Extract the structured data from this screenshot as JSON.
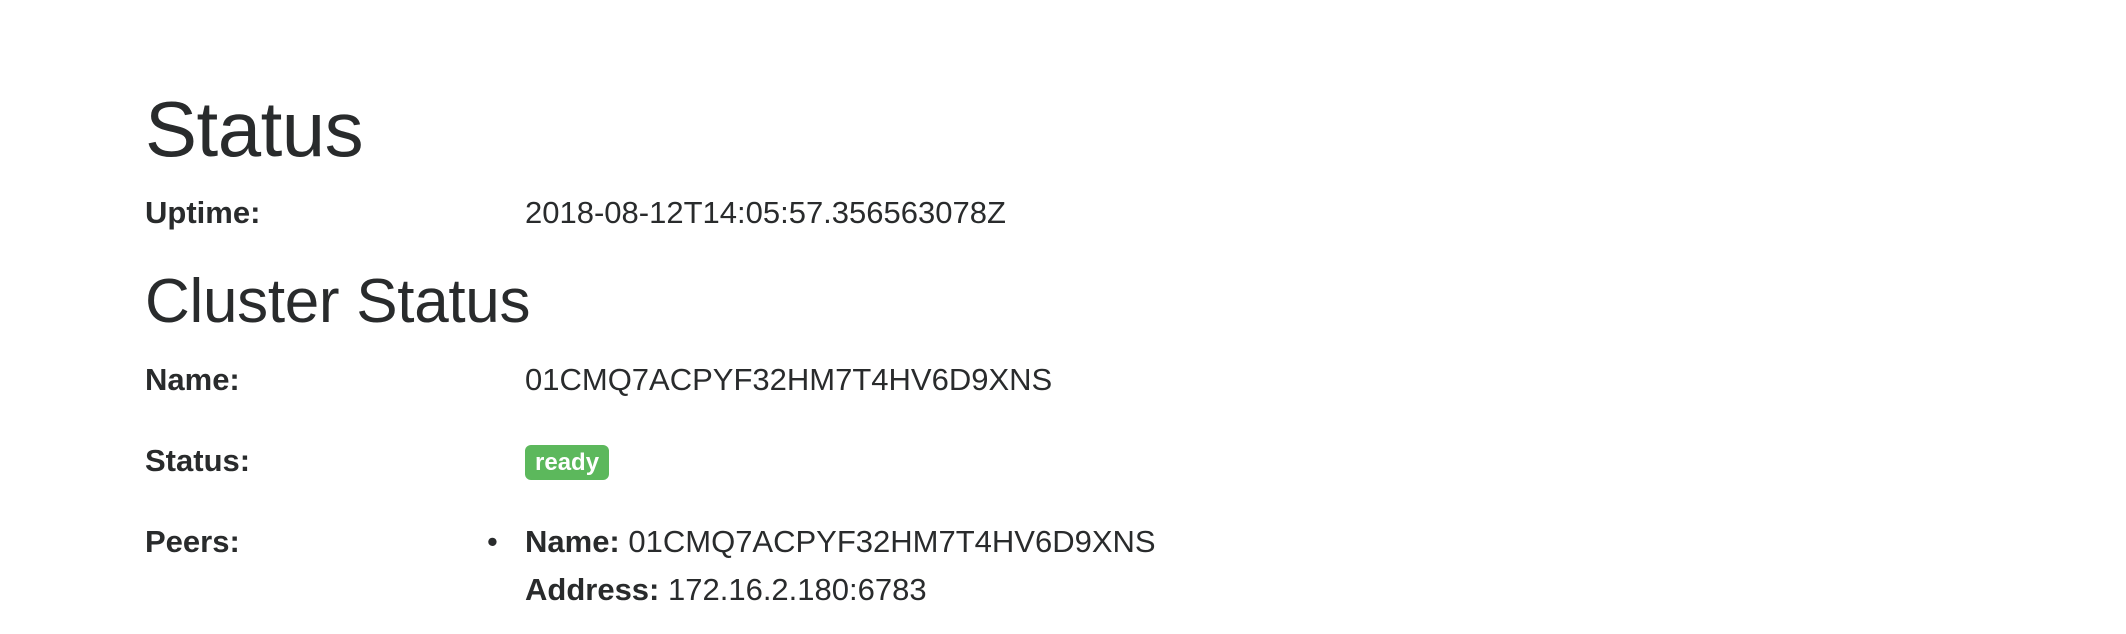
{
  "status_section": {
    "title": "Status",
    "uptime_label": "Uptime:",
    "uptime_value": "2018-08-12T14:05:57.356563078Z"
  },
  "cluster_section": {
    "title": "Cluster Status",
    "name_label": "Name:",
    "name_value": "01CMQ7ACPYF32HM7T4HV6D9XNS",
    "status_label": "Status:",
    "status_badge": "ready",
    "status_badge_color": "#5cb85c",
    "peers_label": "Peers:",
    "peers": [
      {
        "name_key": "Name:",
        "name_value": "01CMQ7ACPYF32HM7T4HV6D9XNS",
        "address_key": "Address:",
        "address_value": "172.16.2.180:6783"
      }
    ]
  }
}
